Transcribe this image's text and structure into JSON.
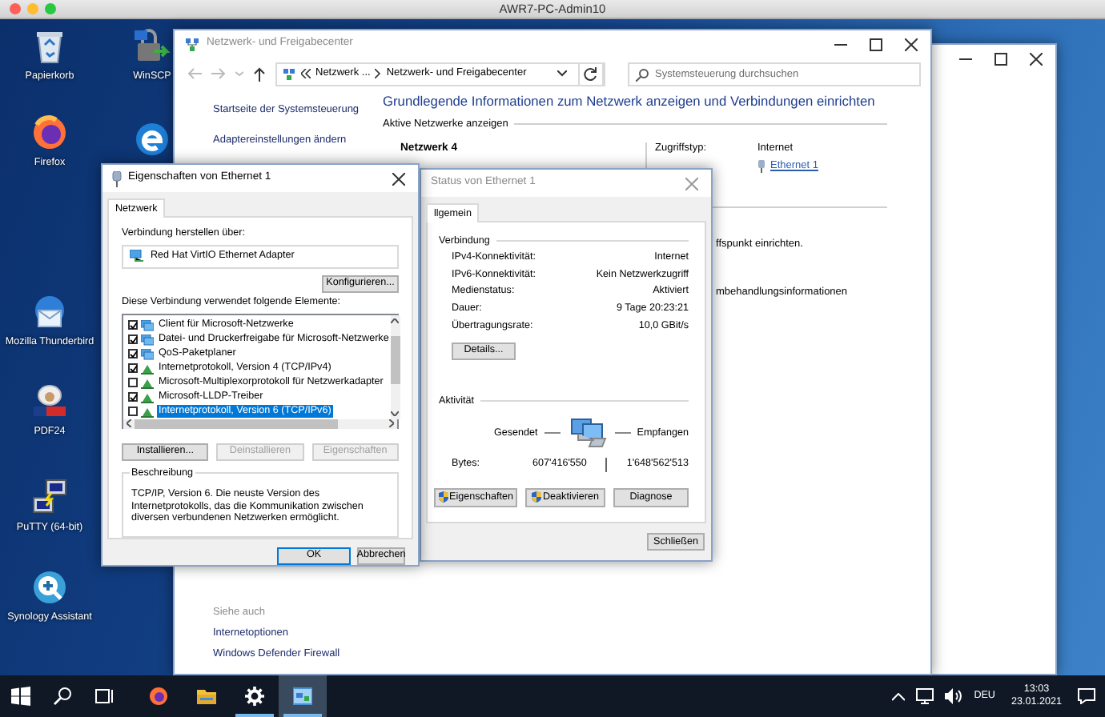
{
  "mac_window": {
    "title": "AWR7-PC-Admin10"
  },
  "desktop_icons": [
    {
      "kind": "recycle-bin",
      "label": "Papierkorb"
    },
    {
      "kind": "winscp",
      "label": "WinSCP"
    },
    {
      "kind": "firefox",
      "label": "Firefox"
    },
    {
      "kind": "edge"
    },
    {
      "kind": "thunderbird",
      "label": "Mozilla Thunderbird"
    },
    {
      "kind": "pdf24",
      "label": "PDF24"
    },
    {
      "kind": "putty",
      "label": "PuTTY (64-bit)"
    },
    {
      "kind": "synology",
      "label": "Synology Assistant"
    }
  ],
  "network_center": {
    "title": "Netzwerk- und Freigabecenter",
    "active": false,
    "breadcrumbs": [
      "Netzwerk ...",
      "Netzwerk- und Freigabecenter"
    ],
    "search": {
      "placeholder": "Systemsteuerung durchsuchen"
    },
    "sidebar_links": [
      "Startseite der Systemsteuerung",
      "Adaptereinstellungen ändern"
    ],
    "heading": "Grundlegende Informationen zum Netzwerk anzeigen und Verbindungen einrichten",
    "section_title": "Aktive Netzwerke anzeigen",
    "network_name": "Netzwerk 4",
    "access_type_label": "Zugriffstyp:",
    "access_type": "Internet",
    "connection": "Ethernet 1",
    "text_fragments": [
      "ffspunkt einrichten.",
      "mbehandlungsinformationen"
    ],
    "see_also": {
      "title": "Siehe auch",
      "links": [
        "Internetoptionen",
        "Windows Defender Firewall"
      ]
    }
  },
  "properties_dialog": {
    "title": "Eigenschaften von Ethernet 1",
    "active": true,
    "tabs": [
      {
        "label": "Netzwerk",
        "selected": true
      }
    ],
    "connect_via_label": "Verbindung herstellen über:",
    "adapter": "Red Hat VirtIO Ethernet Adapter",
    "configure_button": "Konfigurieren...",
    "items_label": "Diese Verbindung verwendet folgende Elemente:",
    "items": [
      {
        "kind": "client",
        "label": "Client für Microsoft-Netzwerke",
        "checked": true,
        "selected": false
      },
      {
        "kind": "client",
        "label": "Datei- und Druckerfreigabe für Microsoft-Netzwerke",
        "checked": true,
        "selected": false
      },
      {
        "kind": "client",
        "label": "QoS-Paketplaner",
        "checked": true,
        "selected": false
      },
      {
        "kind": "protocol",
        "label": "Internetprotokoll, Version 4 (TCP/IPv4)",
        "checked": true,
        "selected": false
      },
      {
        "kind": "protocol",
        "label": "Microsoft-Multiplexorprotokoll für Netzwerkadapter",
        "checked": false,
        "selected": false
      },
      {
        "kind": "protocol",
        "label": "Microsoft-LLDP-Treiber",
        "checked": true,
        "selected": false
      },
      {
        "kind": "protocol",
        "label": "Internetprotokoll, Version 6 (TCP/IPv6)",
        "checked": false,
        "selected": true
      }
    ],
    "item_buttons": [
      {
        "label": "Installieren...",
        "disabled": false
      },
      {
        "label": "Deinstallieren",
        "disabled": true
      },
      {
        "label": "Eigenschaften",
        "disabled": true
      }
    ],
    "description": {
      "title": "Beschreibung",
      "text": "TCP/IP, Version 6. Die neuste Version des Internetprotokolls, das die Kommunikation zwischen diversen verbundenen Netzwerken ermöglicht."
    },
    "footer_buttons": [
      "OK",
      "Abbrechen"
    ]
  },
  "status_dialog": {
    "title": "Status von Ethernet 1",
    "active": false,
    "tabs": [
      {
        "label": "llgemein",
        "selected": true
      }
    ],
    "connection_title": "Verbindung",
    "rows": [
      {
        "label": "IPv4-Konnektivität:",
        "value": "Internet"
      },
      {
        "label": "IPv6-Konnektivität:",
        "value": "Kein Netzwerkzugriff"
      },
      {
        "label": "Medienstatus:",
        "value": "Aktiviert"
      },
      {
        "label": "Dauer:",
        "value": "9 Tage 20:23:21"
      },
      {
        "label": "Übertragungsrate:",
        "value": "10,0 GBit/s"
      }
    ],
    "details_button": "Details...",
    "activity_title": "Aktivität",
    "sent_label": "Gesendet",
    "received_label": "Empfangen",
    "bytes_label": "Bytes:",
    "bytes_sent": "607'416'550",
    "bytes_received": "1'648'562'513",
    "buttons": [
      {
        "label": "Eigenschaften",
        "shield": true
      },
      {
        "label": "Deaktivieren",
        "shield": true
      },
      {
        "label": "Diagnose",
        "shield": false
      }
    ],
    "close_button": "Schließen"
  },
  "taskbar": {
    "apps": [
      {
        "kind": "firefox",
        "running": false,
        "active": false
      },
      {
        "kind": "file-explorer",
        "running": false,
        "active": false
      },
      {
        "kind": "settings",
        "running": true,
        "active": false
      },
      {
        "kind": "network-center",
        "running": true,
        "active": true
      }
    ],
    "language": "DEU",
    "time": "13:03",
    "date": "23.01.2021"
  }
}
